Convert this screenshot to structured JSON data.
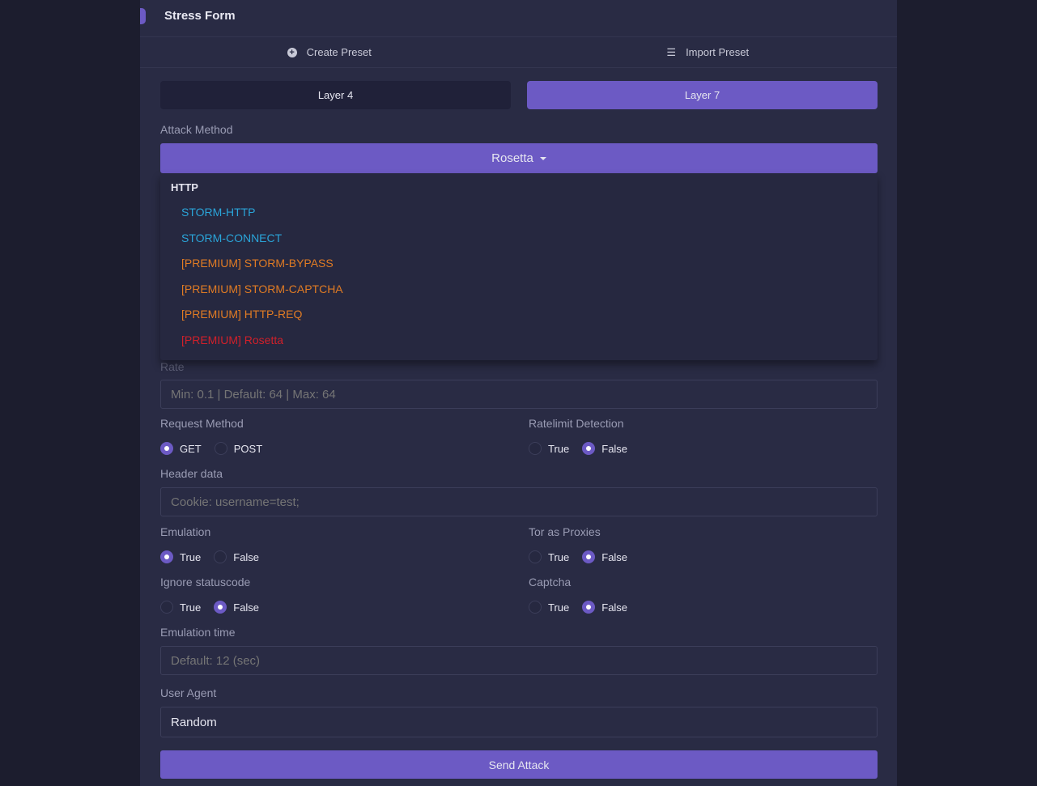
{
  "header": {
    "title": "Stress Form"
  },
  "presets": {
    "create": "Create Preset",
    "import": "Import Preset"
  },
  "layers": {
    "l4": "Layer 4",
    "l7": "Layer 7"
  },
  "attack": {
    "label": "Attack Method",
    "selected": "Rosetta",
    "group": "HTTP",
    "options": [
      {
        "label": "STORM-HTTP",
        "color": "#2aa4d8"
      },
      {
        "label": "STORM-CONNECT",
        "color": "#2aa4d8"
      },
      {
        "label": "[PREMIUM] STORM-BYPASS",
        "color": "#e07b24"
      },
      {
        "label": "[PREMIUM] STORM-CAPTCHA",
        "color": "#e07b24"
      },
      {
        "label": "[PREMIUM] HTTP-REQ",
        "color": "#e07b24"
      },
      {
        "label": "[PREMIUM] Rosetta",
        "color": "#d0202a"
      }
    ]
  },
  "rate": {
    "label": "Rate",
    "placeholder": "Min: 0.1 | Default: 64 | Max: 64"
  },
  "request_method": {
    "label": "Request Method",
    "a": "GET",
    "b": "POST",
    "selected": "GET"
  },
  "ratelimit": {
    "label": "Ratelimit Detection",
    "a": "True",
    "b": "False",
    "selected": "False"
  },
  "header_data": {
    "label": "Header data",
    "placeholder": "Cookie: username=test;"
  },
  "emulation": {
    "label": "Emulation",
    "a": "True",
    "b": "False",
    "selected": "True"
  },
  "tor": {
    "label": "Tor as Proxies",
    "a": "True",
    "b": "False",
    "selected": "False"
  },
  "ignore": {
    "label": "Ignore statuscode",
    "a": "True",
    "b": "False",
    "selected": "False"
  },
  "captcha": {
    "label": "Captcha",
    "a": "True",
    "b": "False",
    "selected": "False"
  },
  "emulation_time": {
    "label": "Emulation time",
    "placeholder": "Default: 12 (sec)"
  },
  "user_agent": {
    "label": "User Agent",
    "value": "Random"
  },
  "send": "Send Attack"
}
